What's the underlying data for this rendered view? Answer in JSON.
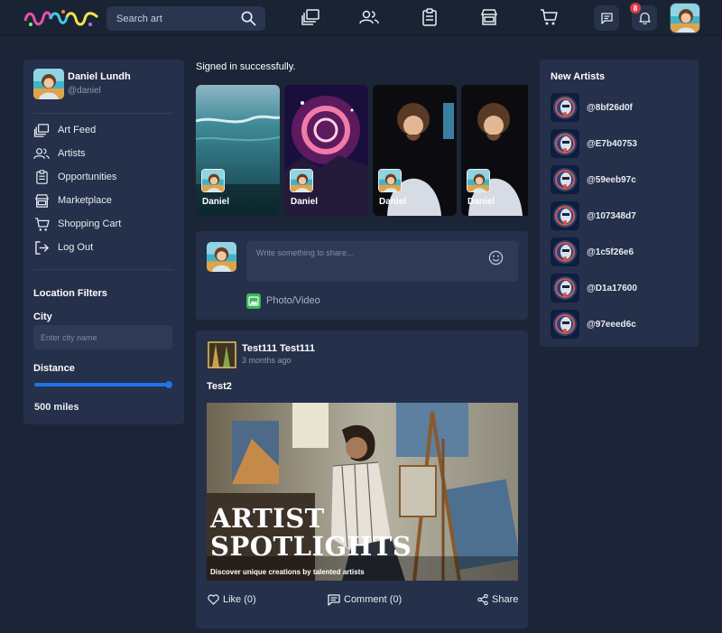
{
  "header": {
    "search_placeholder": "Search art",
    "nav_icons": [
      "art-feed-icon",
      "artists-icon",
      "opportunities-icon",
      "marketplace-icon",
      "cart-icon"
    ],
    "notification_count": "8"
  },
  "profile": {
    "name": "Daniel Lundh",
    "handle": "@daniel"
  },
  "sidebar": {
    "items": [
      {
        "label": "Art Feed",
        "icon": "art-feed-icon"
      },
      {
        "label": "Artists",
        "icon": "artists-icon"
      },
      {
        "label": "Opportunities",
        "icon": "clipboard-icon"
      },
      {
        "label": "Marketplace",
        "icon": "store-icon"
      },
      {
        "label": "Shopping Cart",
        "icon": "cart-icon"
      },
      {
        "label": "Log Out",
        "icon": "logout-icon"
      }
    ]
  },
  "filters": {
    "title": "Location Filters",
    "city_label": "City",
    "city_placeholder": "Enter city name",
    "distance_label": "Distance",
    "distance_value": "500 miles",
    "distance_fraction": 1.0
  },
  "main": {
    "status_message": "Signed in successfully.",
    "stories": [
      {
        "name": "Daniel"
      },
      {
        "name": "Daniel"
      },
      {
        "name": "Daniel"
      },
      {
        "name": "Daniel"
      }
    ],
    "composer": {
      "placeholder": "Write something to share...",
      "photo_label": "Photo/Video"
    },
    "post": {
      "author": "Test111 Test111",
      "time": "3 months ago",
      "text": "Test2",
      "image_headline_1": "ARTIST",
      "image_headline_2": "SPOTLIGHTS",
      "image_tagline": "Discover unique creations by talented artists",
      "like_label": "Like (0)",
      "comment_label": "Comment (0)",
      "share_label": "Share"
    }
  },
  "new_artists": {
    "title": "New Artists",
    "items": [
      "@8bf26d0f",
      "@E7b40753",
      "@59eeb97c",
      "@107348d7",
      "@1c5f26e6",
      "@D1a17600",
      "@97eeed6c"
    ]
  },
  "colors": {
    "background": "#1c2537",
    "card": "#25304a",
    "accent": "#1e74e8",
    "badge": "#e03a4a"
  }
}
